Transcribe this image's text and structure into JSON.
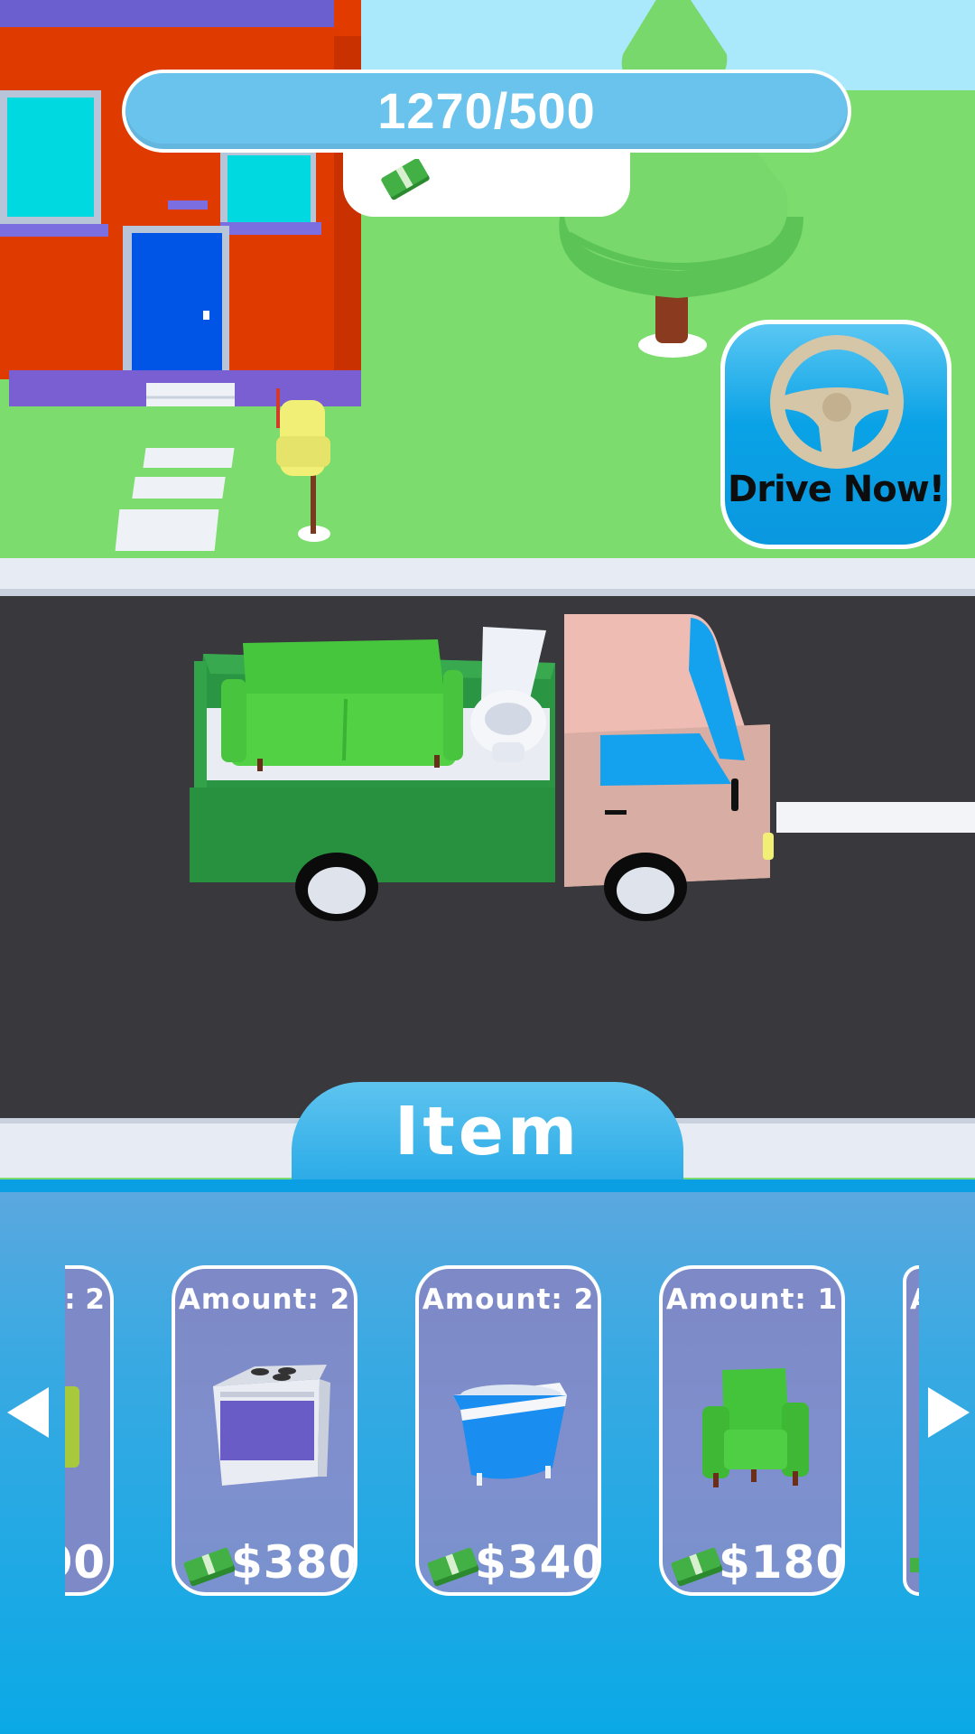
{
  "hud": {
    "progress_text": "1270/500",
    "progress_icon": "cash-icon"
  },
  "drive_button": {
    "label": "Drive Now!",
    "icon": "steering-wheel-icon"
  },
  "shop": {
    "tab_label": "Item",
    "partial_left": {
      "amount_fragment": ": 2",
      "price_fragment": "90"
    },
    "cards": [
      {
        "amount": "Amount: 2",
        "price": "$380",
        "item_icon": "stove-icon"
      },
      {
        "amount": "Amount: 2",
        "price": "$340",
        "item_icon": "bathtub-icon"
      },
      {
        "amount": "Amount: 1",
        "price": "$180",
        "item_icon": "armchair-icon"
      }
    ],
    "partial_right": {
      "amount_fragment": "A"
    }
  },
  "colors": {
    "panel": "#0aa9e6",
    "card": "#7e89c7",
    "lawn": "#7ddc6e",
    "road": "#38383d"
  }
}
